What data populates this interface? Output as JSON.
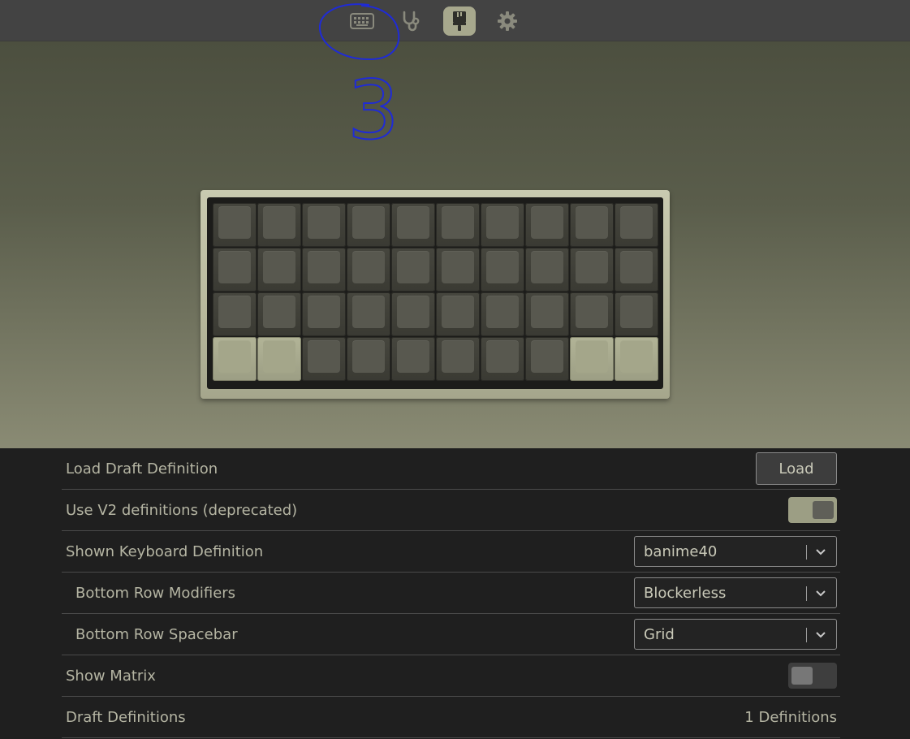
{
  "nav": {
    "items": [
      {
        "name": "keyboard-icon",
        "active": false
      },
      {
        "name": "stethoscope-icon",
        "active": false
      },
      {
        "name": "paintbrush-icon",
        "active": true
      },
      {
        "name": "gear-icon",
        "active": false
      }
    ]
  },
  "annotation": {
    "number": "3",
    "color": "#1f2bd6"
  },
  "keyboard": {
    "rows": 4,
    "cols": 10,
    "light_keys": [
      "3-0",
      "3-1",
      "3-8",
      "3-9"
    ],
    "colors": {
      "dark_key": "#58584f",
      "light_key": "#a4a68a",
      "case": "#c9cab0"
    }
  },
  "settings": {
    "load_draft": {
      "label": "Load Draft Definition",
      "button": "Load"
    },
    "use_v2": {
      "label": "Use V2 definitions (deprecated)",
      "enabled": true
    },
    "shown_definition": {
      "label": "Shown Keyboard Definition",
      "value": "banime40"
    },
    "bottom_row_modifiers": {
      "label": "Bottom Row Modifiers",
      "value": "Blockerless"
    },
    "bottom_row_spacebar": {
      "label": "Bottom Row Spacebar",
      "value": "Grid"
    },
    "show_matrix": {
      "label": "Show Matrix",
      "enabled": false
    },
    "draft_definitions": {
      "label": "Draft Definitions",
      "count": "1 Definitions"
    }
  }
}
